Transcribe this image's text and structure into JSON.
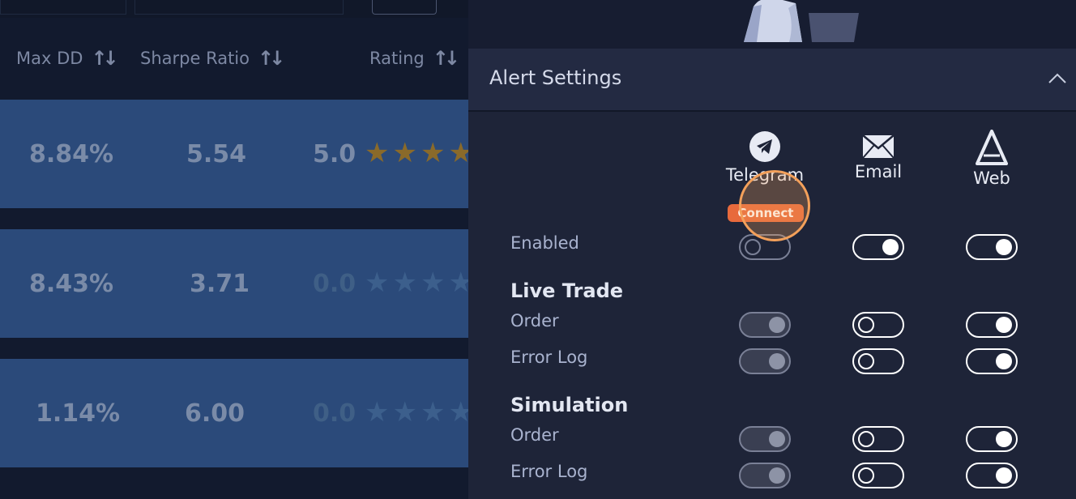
{
  "table": {
    "columns": [
      {
        "label": "Max DD"
      },
      {
        "label": "Sharpe Ratio"
      },
      {
        "label": "Rating"
      }
    ],
    "rows": [
      {
        "max_dd": "8.84%",
        "sharpe": "5.54",
        "rating": "5.0",
        "stars_filled": 3
      },
      {
        "max_dd": "8.43%",
        "sharpe": "3.71",
        "rating": "0.0",
        "stars_filled": 0
      },
      {
        "max_dd": "1.14%",
        "sharpe": "6.00",
        "rating": "0.0",
        "stars_filled": 0
      }
    ],
    "star_glyph": "★★★★",
    "colors": {
      "filled_star": "#8a6a2a",
      "empty_star": "#3c5f8c",
      "zero_rating": "#3f5f86",
      "rated": "#7a8ba8"
    }
  },
  "panel": {
    "title": "Alert Settings",
    "channels": [
      {
        "label": "Telegram",
        "icon": "telegram-icon"
      },
      {
        "label": "Email",
        "icon": "envelope-icon"
      },
      {
        "label": "Web",
        "icon": "web-logo-icon"
      }
    ],
    "connect_label": "Connect",
    "enabled_label": "Enabled",
    "sections": [
      {
        "title": "Live Trade",
        "items": [
          {
            "label": "Order"
          },
          {
            "label": "Error Log"
          }
        ]
      },
      {
        "title": "Simulation",
        "items": [
          {
            "label": "Order"
          },
          {
            "label": "Error Log"
          }
        ]
      }
    ],
    "toggles": {
      "enabled": [
        "off-disabled",
        "on",
        "on"
      ],
      "live_order": [
        "on-disabled",
        "off",
        "on"
      ],
      "live_error": [
        "on-disabled",
        "off",
        "on"
      ],
      "sim_order": [
        "on-disabled",
        "off",
        "on"
      ],
      "sim_error": [
        "on-disabled",
        "off",
        "on"
      ]
    },
    "accent_color": "#e86a3c"
  }
}
